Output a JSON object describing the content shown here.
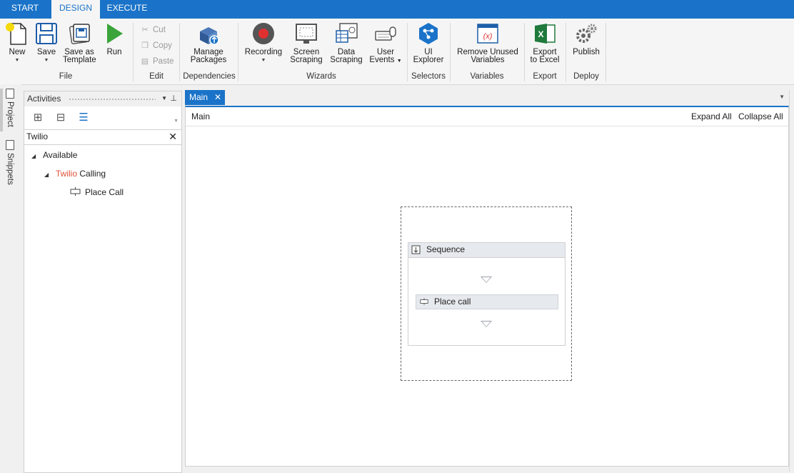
{
  "top_tabs": [
    "START",
    "DESIGN",
    "EXECUTE"
  ],
  "ribbon": {
    "file": {
      "new": "New",
      "save": "Save",
      "save_as_template_1": "Save as",
      "save_as_template_2": "Template",
      "run": "Run",
      "group": "File"
    },
    "edit": {
      "cut": "Cut",
      "copy": "Copy",
      "paste": "Paste",
      "group": "Edit"
    },
    "dependencies": {
      "manage_1": "Manage",
      "manage_2": "Packages",
      "group": "Dependencies"
    },
    "wizards": {
      "recording": "Recording",
      "screen_1": "Screen",
      "screen_2": "Scraping",
      "data_1": "Data",
      "data_2": "Scraping",
      "user_1": "User",
      "user_2": "Events",
      "group": "Wizards"
    },
    "selectors": {
      "ui_1": "UI",
      "ui_2": "Explorer",
      "group": "Selectors"
    },
    "variables": {
      "remove_1": "Remove Unused",
      "remove_2": "Variables",
      "group": "Variables"
    },
    "export": {
      "excel_1": "Export",
      "excel_2": "to Excel",
      "group": "Export"
    },
    "deploy": {
      "publish": "Publish",
      "group": "Deploy"
    }
  },
  "side_tabs": {
    "project": "Project",
    "snippets": "Snippets"
  },
  "activities": {
    "title": "Activities",
    "search_value": "Twilio",
    "tree": {
      "available": "Available",
      "category_highlight": "Twilio",
      "category_rest": " Calling",
      "item": "Place Call"
    }
  },
  "designer": {
    "tab": "Main",
    "breadcrumb": "Main",
    "expand_all": "Expand All",
    "collapse_all": "Collapse All",
    "sequence_title": "Sequence",
    "activity_title": "Place call"
  },
  "colors": {
    "accent": "#1a73c8",
    "highlight_text": "#e0523a",
    "run_green": "#3aa43a",
    "record_red": "#e03030",
    "excel_green": "#1f7a3c"
  }
}
